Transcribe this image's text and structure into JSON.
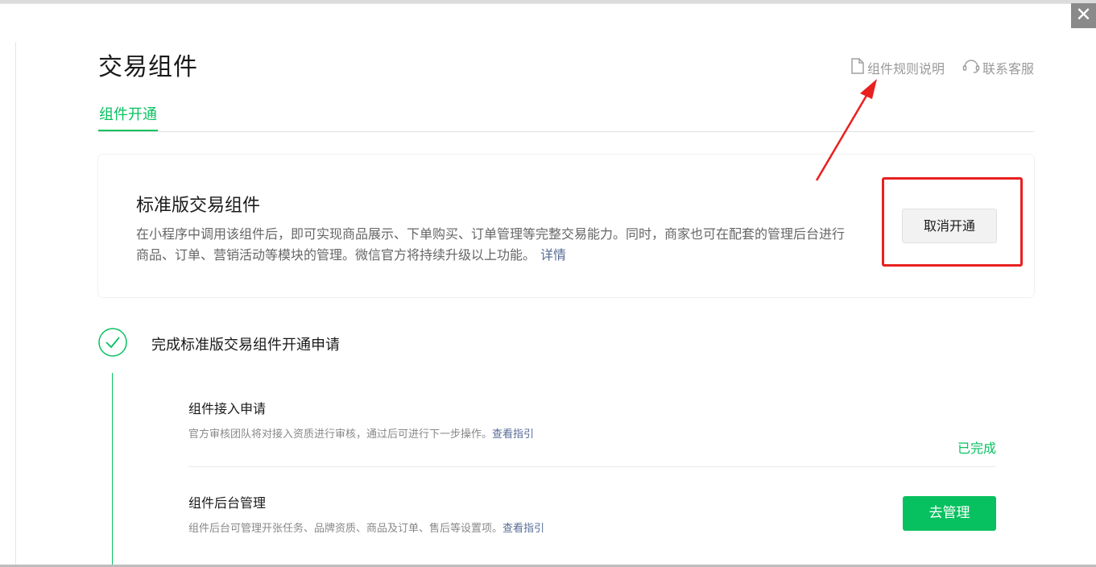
{
  "window": {
    "close_glyph": "✕"
  },
  "header": {
    "title": "交易组件",
    "links": [
      {
        "label": "组件规则说明",
        "icon": "document-icon"
      },
      {
        "label": "联系客服",
        "icon": "headset-icon"
      }
    ]
  },
  "tabs": [
    {
      "label": "组件开通",
      "active": true
    }
  ],
  "card": {
    "title": "标准版交易组件",
    "description": "在小程序中调用该组件后，即可实现商品展示、下单购买、订单管理等完整交易能力。同时，商家也可在配套的管理后台进行商品、订单、营销活动等模块的管理。微信官方将持续升级以上功能。",
    "details_link": "详情",
    "cancel_button": "取消开通"
  },
  "step": {
    "title": "完成标准版交易组件开通申请",
    "items": [
      {
        "title": "组件接入申请",
        "desc": "官方审核团队将对接入资质进行审核，通过后可进行下一步操作。",
        "link": "查看指引",
        "status": "已完成"
      },
      {
        "title": "组件后台管理",
        "desc": "组件后台可管理开张任务、品牌资质、商品及订单、售后等设置项。",
        "link": "查看指引",
        "action": "去管理"
      }
    ]
  },
  "colors": {
    "accent": "#07c160",
    "link": "#576b95",
    "annotation": "#e92020"
  }
}
